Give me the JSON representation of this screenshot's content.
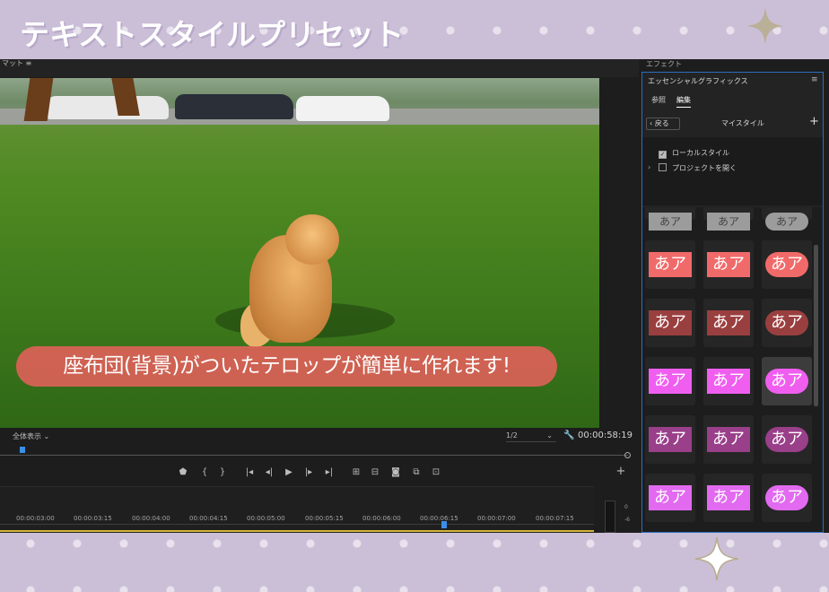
{
  "banner": {
    "title": "テキストスタイルプリセット"
  },
  "monitor": {
    "header_label": "マット ≡",
    "caption": "座布団(背景)がついたテロップが簡単に作れます!",
    "zoom": "全体表示",
    "resolution": "1/2",
    "timecode": "00:00:58:19"
  },
  "timeline": {
    "ruler": [
      "00:00:03:00",
      "00:00:03:15",
      "00:00:04:00",
      "00:00:04:15",
      "00:00:05:00",
      "00:00:05:15",
      "00:00:06:00",
      "00:00:06:15",
      "00:00:07:00",
      "00:00:07:15"
    ],
    "vu_labels": [
      "0",
      "-6"
    ]
  },
  "panel": {
    "effects_label": "エフェクト",
    "title": "エッセンシャルグラフィックス",
    "menu": "≡",
    "tabs": [
      {
        "label": "参照"
      },
      {
        "label": "編集"
      }
    ],
    "back": "戻る",
    "my_style": "マイスタイル",
    "add": "+",
    "tree": [
      {
        "label": "ローカルスタイル",
        "checked": true
      },
      {
        "label": "プロジェクトを開く",
        "checked": false
      }
    ]
  },
  "presets": {
    "label": "あア",
    "rows": [
      [
        {
          "bg": "#f16a6a",
          "shape": "rect"
        },
        {
          "bg": "#f16a6a",
          "shape": "rect"
        },
        {
          "bg": "#f16a6a",
          "shape": "round"
        }
      ],
      [
        {
          "bg": "#9a3f3f",
          "shape": "rect"
        },
        {
          "bg": "#9a3f3f",
          "shape": "rect"
        },
        {
          "bg": "#9a3f3f",
          "shape": "round"
        }
      ],
      [
        {
          "bg": "#f05ef0",
          "shape": "rect"
        },
        {
          "bg": "#f05ef0",
          "shape": "rect"
        },
        {
          "bg": "#f05ef0",
          "shape": "round",
          "selected": true
        }
      ],
      [
        {
          "bg": "#9a3f8a",
          "shape": "rect"
        },
        {
          "bg": "#9a3f8a",
          "shape": "rect"
        },
        {
          "bg": "#9a3f8a",
          "shape": "round"
        }
      ],
      [
        {
          "bg": "#e26af0",
          "shape": "rect"
        },
        {
          "bg": "#e26af0",
          "shape": "rect"
        },
        {
          "bg": "#e26af0",
          "shape": "round"
        }
      ]
    ]
  }
}
